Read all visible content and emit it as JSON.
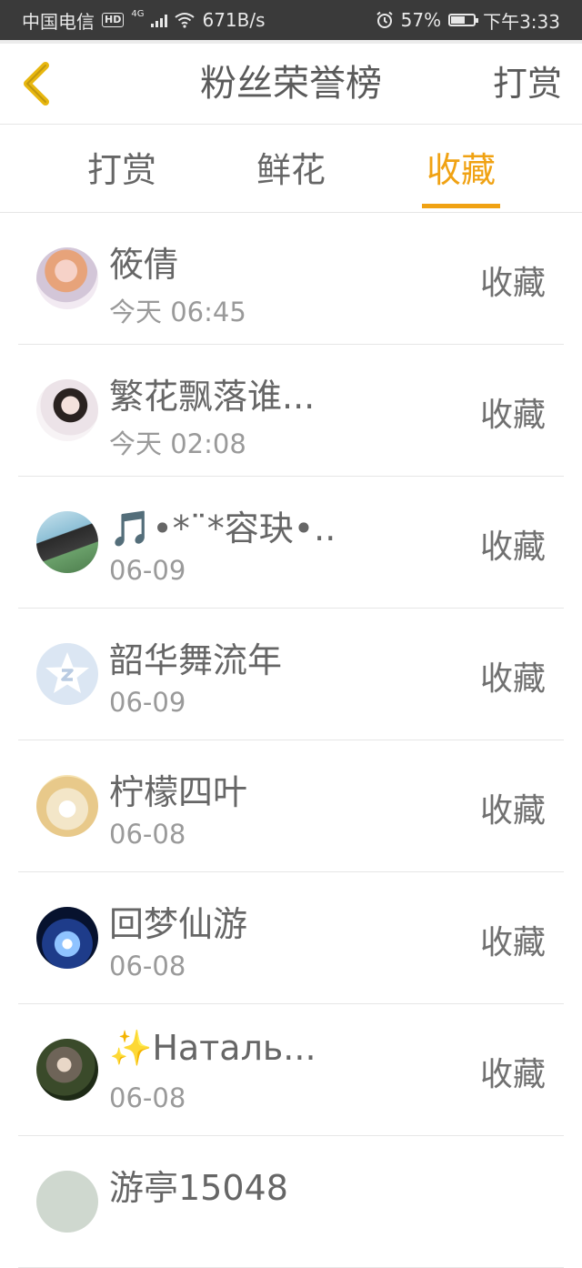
{
  "status_bar": {
    "carrier": "中国电信",
    "hd_badge": "HD",
    "network_type": "4G",
    "speed": "671B/s",
    "battery_percent": "57%",
    "time": "下午3:33",
    "icons": [
      "hd-icon",
      "signal-icon",
      "wifi-icon",
      "alarm-icon",
      "battery-icon"
    ]
  },
  "header": {
    "title": "粉丝荣誉榜",
    "right_action": "打赏",
    "back_icon": "chevron-left-icon",
    "back_icon_color": "#e8b70f"
  },
  "tabs": [
    {
      "label": "打赏",
      "active": false
    },
    {
      "label": "鲜花",
      "active": false
    },
    {
      "label": "收藏",
      "active": true
    }
  ],
  "colors": {
    "accent": "#f0a213",
    "text": "#666666",
    "subtext": "#9a9a9a",
    "divider": "#e6e6e6"
  },
  "fans": [
    {
      "name": "筱倩",
      "time": "今天 06:45",
      "action": "收藏"
    },
    {
      "name": "繁花飘落谁...",
      "time": "今天 02:08",
      "action": "收藏"
    },
    {
      "name": "🎵•*¨*容玦•...",
      "time": "06-09",
      "action": "收藏"
    },
    {
      "name": "韶华舞流年",
      "time": "06-09",
      "action": "收藏"
    },
    {
      "name": "柠檬四叶",
      "time": "06-08",
      "action": "收藏"
    },
    {
      "name": "回梦仙游",
      "time": "06-08",
      "action": "收藏"
    },
    {
      "name": "✨Наталь...",
      "time": "06-08",
      "action": "收藏"
    },
    {
      "name": "游亭15048",
      "time": "",
      "action": ""
    }
  ]
}
